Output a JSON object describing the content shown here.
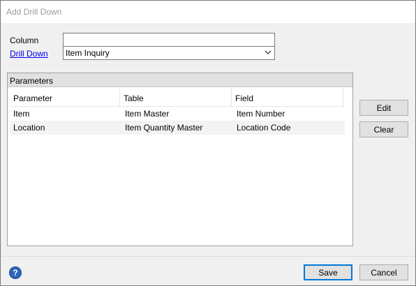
{
  "window": {
    "title": "Add Drill Down"
  },
  "form": {
    "column_label": "Column",
    "column_value": "",
    "drilldown_label": "Drill Down",
    "drilldown_value": "Item Inquiry"
  },
  "parameters": {
    "group_label": "Parameters",
    "columns": [
      "Parameter",
      "Table",
      "Field"
    ],
    "rows": [
      {
        "parameter": "Item",
        "table": "Item Master",
        "field": "Item Number"
      },
      {
        "parameter": "Location",
        "table": "Item Quantity Master",
        "field": "Location Code"
      }
    ]
  },
  "buttons": {
    "edit": "Edit",
    "clear": "Clear",
    "save": "Save",
    "cancel": "Cancel"
  },
  "icons": {
    "help": "help-icon",
    "dropdown": "chevron-down-icon"
  }
}
